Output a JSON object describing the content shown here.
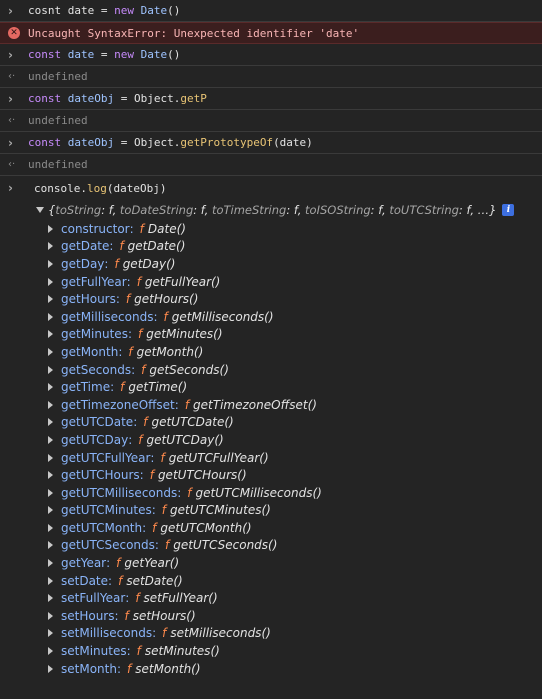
{
  "entries": [
    {
      "type": "input",
      "parts": [
        {
          "cls": "plain",
          "text": "cosnt date = "
        },
        {
          "cls": "kw",
          "text": "new"
        },
        {
          "cls": "plain",
          "text": " "
        },
        {
          "cls": "var",
          "text": "Date"
        },
        {
          "cls": "plain",
          "text": "()"
        }
      ]
    },
    {
      "type": "error",
      "text": "Uncaught SyntaxError: Unexpected identifier 'date'"
    },
    {
      "type": "input",
      "parts": [
        {
          "cls": "kw",
          "text": "const"
        },
        {
          "cls": "plain",
          "text": " "
        },
        {
          "cls": "var",
          "text": "date"
        },
        {
          "cls": "plain",
          "text": " = "
        },
        {
          "cls": "kw",
          "text": "new"
        },
        {
          "cls": "plain",
          "text": " "
        },
        {
          "cls": "var",
          "text": "Date"
        },
        {
          "cls": "plain",
          "text": "()"
        }
      ]
    },
    {
      "type": "result",
      "text": "undefined"
    },
    {
      "type": "input",
      "parts": [
        {
          "cls": "kw",
          "text": "const"
        },
        {
          "cls": "plain",
          "text": " "
        },
        {
          "cls": "var",
          "text": "dateObj"
        },
        {
          "cls": "plain",
          "text": " = Object."
        },
        {
          "cls": "fn",
          "text": "getP"
        }
      ]
    },
    {
      "type": "result",
      "text": "undefined"
    },
    {
      "type": "input",
      "parts": [
        {
          "cls": "kw",
          "text": "const"
        },
        {
          "cls": "plain",
          "text": " "
        },
        {
          "cls": "var",
          "text": "dateObj"
        },
        {
          "cls": "plain",
          "text": " = Object."
        },
        {
          "cls": "fn",
          "text": "getPrototypeOf"
        },
        {
          "cls": "plain",
          "text": "(date)"
        }
      ]
    },
    {
      "type": "result",
      "text": "undefined"
    }
  ],
  "log_command": {
    "parts": [
      {
        "cls": "plain",
        "text": "console."
      },
      {
        "cls": "fn",
        "text": "log"
      },
      {
        "cls": "plain",
        "text": "(dateObj)"
      }
    ]
  },
  "object_summary": {
    "items": [
      "toString",
      "toDateString",
      "toTimeString",
      "toISOString",
      "toUTCString"
    ],
    "f_symbol": "f",
    "ellipsis": "…",
    "info_badge": "i"
  },
  "properties": [
    {
      "key": "constructor",
      "sig": "Date()"
    },
    {
      "key": "getDate",
      "sig": "getDate()"
    },
    {
      "key": "getDay",
      "sig": "getDay()"
    },
    {
      "key": "getFullYear",
      "sig": "getFullYear()"
    },
    {
      "key": "getHours",
      "sig": "getHours()"
    },
    {
      "key": "getMilliseconds",
      "sig": "getMilliseconds()"
    },
    {
      "key": "getMinutes",
      "sig": "getMinutes()"
    },
    {
      "key": "getMonth",
      "sig": "getMonth()"
    },
    {
      "key": "getSeconds",
      "sig": "getSeconds()"
    },
    {
      "key": "getTime",
      "sig": "getTime()"
    },
    {
      "key": "getTimezoneOffset",
      "sig": "getTimezoneOffset()"
    },
    {
      "key": "getUTCDate",
      "sig": "getUTCDate()"
    },
    {
      "key": "getUTCDay",
      "sig": "getUTCDay()"
    },
    {
      "key": "getUTCFullYear",
      "sig": "getUTCFullYear()"
    },
    {
      "key": "getUTCHours",
      "sig": "getUTCHours()"
    },
    {
      "key": "getUTCMilliseconds",
      "sig": "getUTCMilliseconds()"
    },
    {
      "key": "getUTCMinutes",
      "sig": "getUTCMinutes()"
    },
    {
      "key": "getUTCMonth",
      "sig": "getUTCMonth()"
    },
    {
      "key": "getUTCSeconds",
      "sig": "getUTCSeconds()"
    },
    {
      "key": "getYear",
      "sig": "getYear()"
    },
    {
      "key": "setDate",
      "sig": "setDate()"
    },
    {
      "key": "setFullYear",
      "sig": "setFullYear()"
    },
    {
      "key": "setHours",
      "sig": "setHours()"
    },
    {
      "key": "setMilliseconds",
      "sig": "setMilliseconds()"
    },
    {
      "key": "setMinutes",
      "sig": "setMinutes()"
    },
    {
      "key": "setMonth",
      "sig": "setMonth()"
    }
  ],
  "colors": {
    "background": "#242424",
    "keyword": "#c58af9",
    "variable": "#9fc4ff",
    "function": "#e8c475",
    "property_key": "#8ab4f8",
    "f_marker": "#ff8a4c",
    "error_bg": "#3b1e1e",
    "error_text": "#f9b5b5"
  },
  "icons": {
    "input_prompt": "›",
    "result_arrow": "‹·",
    "error": "✕"
  }
}
